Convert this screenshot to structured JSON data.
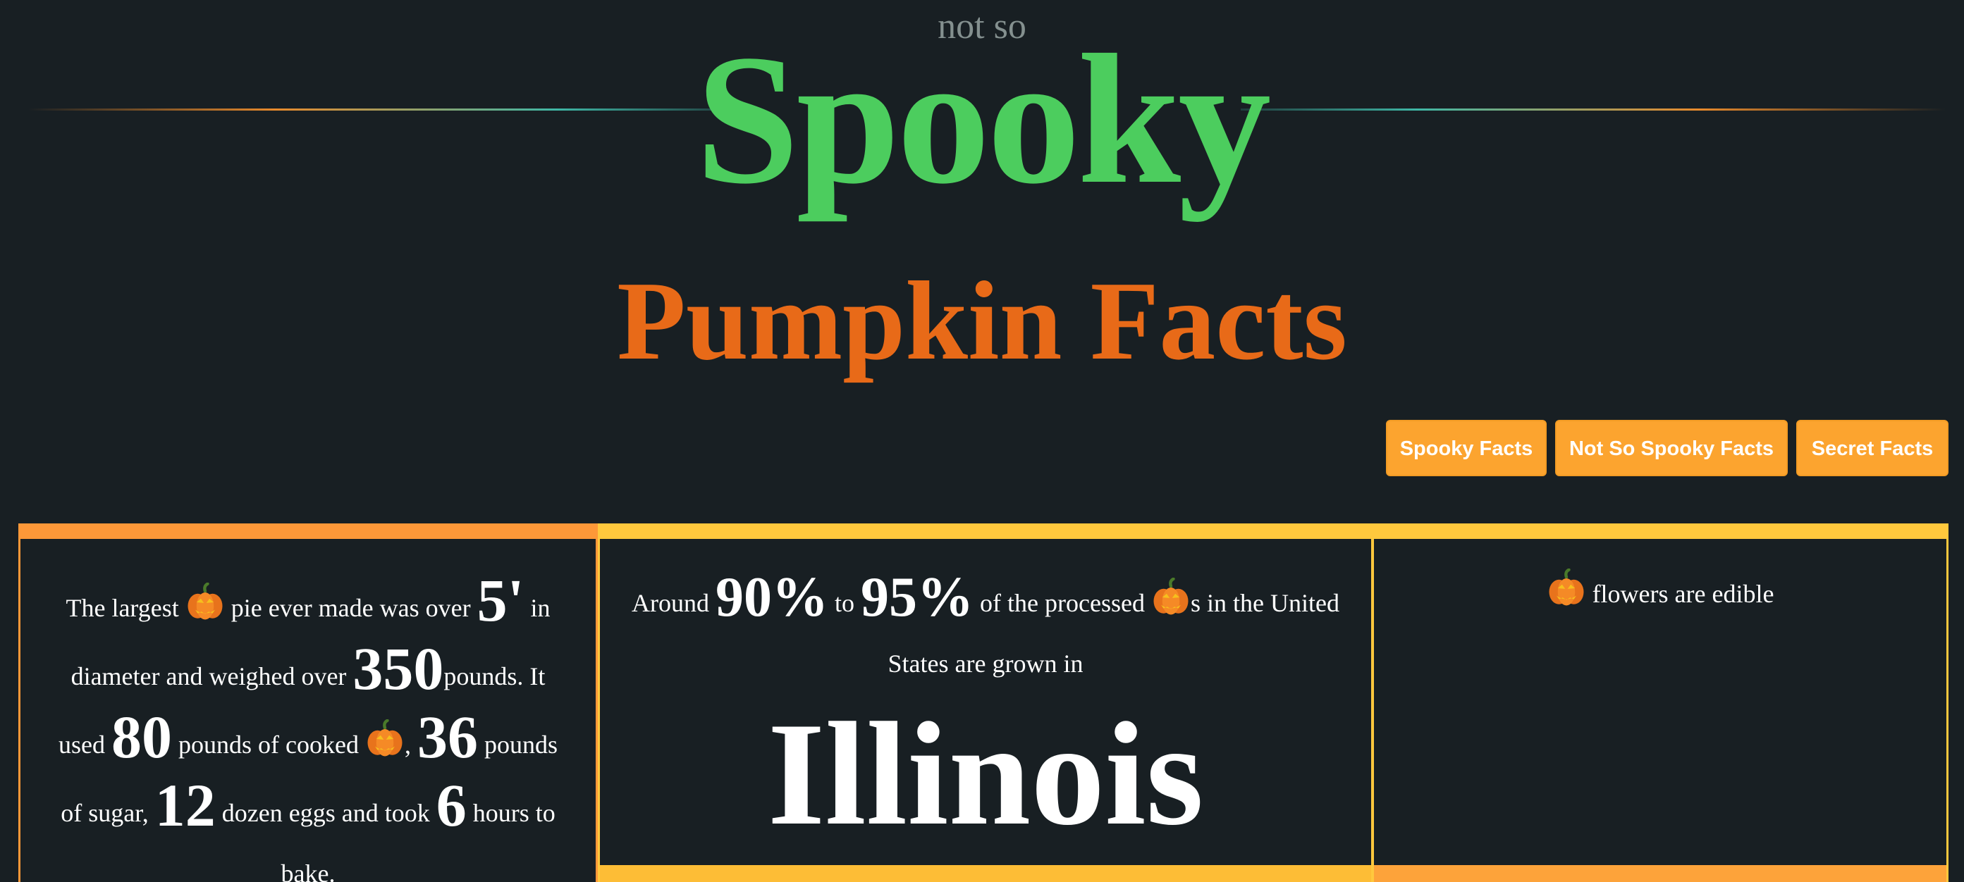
{
  "header": {
    "prefix": "not so",
    "title": "Spooky",
    "subtitle": "Pumpkin Facts"
  },
  "nav": {
    "buttons": [
      "Spooky Facts",
      "Not So Spooky Facts",
      "Secret Facts"
    ]
  },
  "facts": {
    "fact1": {
      "t1": "The largest",
      "t2": "pie ever made was over",
      "n1": "5'",
      "t3": "in diameter and weighed over",
      "n2": "350",
      "t4": "pounds. It used",
      "n3": "80",
      "t5": "pounds of cooked",
      "t6": ",",
      "n4": "36",
      "t7": "pounds of sugar,",
      "n5": "12",
      "t8": "dozen eggs and took",
      "n6": "6",
      "t9": "hours to bake."
    },
    "fact2": {
      "t1": "Around",
      "n1": "90%",
      "t2": "to",
      "n2": "95%",
      "t3": "of the processed",
      "t4": "s in the United States are grown in",
      "place": "Illinois"
    },
    "fact3": {
      "t1": "flowers are edible"
    }
  },
  "icons": {
    "pumpkin": "jack-o-lantern-icon"
  },
  "colors": {
    "background": "#181f23",
    "title_green": "#4ccd5e",
    "subtitle_orange": "#e86a18",
    "button": "#fca42f",
    "card_orange": "#fd9838",
    "card_yellow": "#ffc83d"
  }
}
